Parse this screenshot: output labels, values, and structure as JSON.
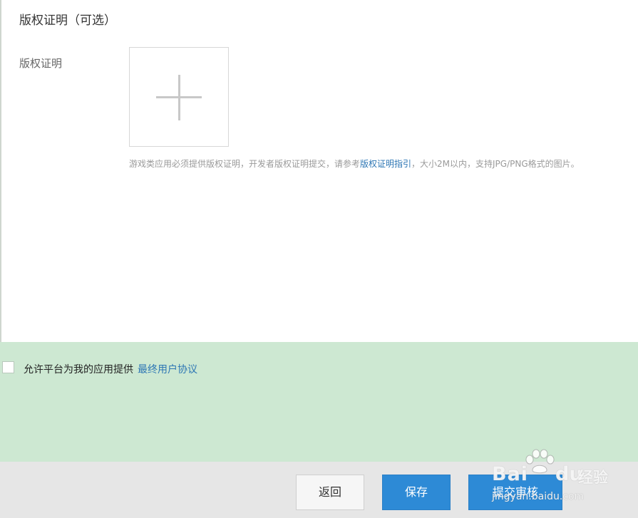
{
  "section": {
    "title": "版权证明（可选）"
  },
  "copyright_field": {
    "label": "版权证明",
    "upload_icon": "plus-icon",
    "hint_before": "游戏类应用必须提供版权证明，开发者版权证明提交，请参考",
    "hint_link": "版权证明指引",
    "hint_after": "，大小2M以内，支持JPG/PNG格式的图片。"
  },
  "agreement": {
    "text": "允许平台为我的应用提供",
    "link": "最终用户协议"
  },
  "buttons": {
    "back": "返回",
    "save": "保存",
    "submit": "提交审核"
  },
  "watermark": {
    "brand_bai": "Bai",
    "brand_du": "du",
    "brand_jingyan": "经验",
    "url": "jingyan.baidu.com"
  },
  "colors": {
    "link": "#2d76b4",
    "primary": "#2d8ad6",
    "agreement_bg": "#cde8d2",
    "footer_bg": "#e6e6e6"
  }
}
